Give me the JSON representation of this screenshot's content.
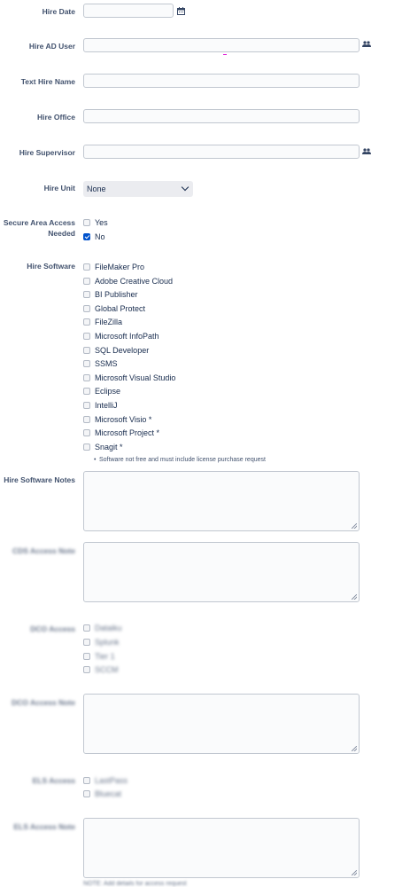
{
  "fields": {
    "hire_date": {
      "label": "Hire Date",
      "icon": "calendar-icon"
    },
    "hire_ad_user": {
      "label": "Hire AD User",
      "icon": "user-group-icon"
    },
    "text_hire_name": {
      "label": "Text Hire Name"
    },
    "hire_office": {
      "label": "Hire Office"
    },
    "hire_supervisor": {
      "label": "Hire Supervisor",
      "icon": "user-group-icon"
    },
    "hire_unit": {
      "label": "Hire Unit",
      "selected": "None"
    },
    "secure_area": {
      "label_line1": "Secure Area Access",
      "label_line2": "Needed",
      "options": [
        {
          "label": "Yes",
          "checked": false
        },
        {
          "label": "No",
          "checked": true
        }
      ]
    },
    "hire_software": {
      "label": "Hire Software",
      "options": [
        "FileMaker Pro",
        "Adobe Creative Cloud",
        "BI Publisher",
        "Global Protect",
        "FileZilla",
        "Microsoft InfoPath",
        "SQL Developer",
        "SSMS",
        "Microsoft Visual Studio",
        "Eclipse",
        "IntelliJ",
        "Microsoft Visio *",
        "Microsoft Project *",
        "Snagit *"
      ],
      "note": "Software not free and must include license purchase request"
    },
    "hire_software_notes": {
      "label": "Hire Software Notes"
    },
    "cds_access_note": {
      "label": "CDS Access Note"
    },
    "dco_access": {
      "label": "DCO Access",
      "options": [
        "Dataiku",
        "Splunk",
        "Tier 1",
        "SCCM"
      ]
    },
    "dco_access_note": {
      "label": "DCO Access Note"
    },
    "els_access": {
      "label": "ELS Access",
      "options": [
        "LastPass",
        "Bluecat"
      ]
    },
    "els_access_note": {
      "label": "ELS Access Note"
    },
    "bottom_note": "NOTE: Add details for access request"
  },
  "colors": {
    "accent": "#0052cc",
    "label": "#42526e",
    "border": "#c1c7d0"
  }
}
